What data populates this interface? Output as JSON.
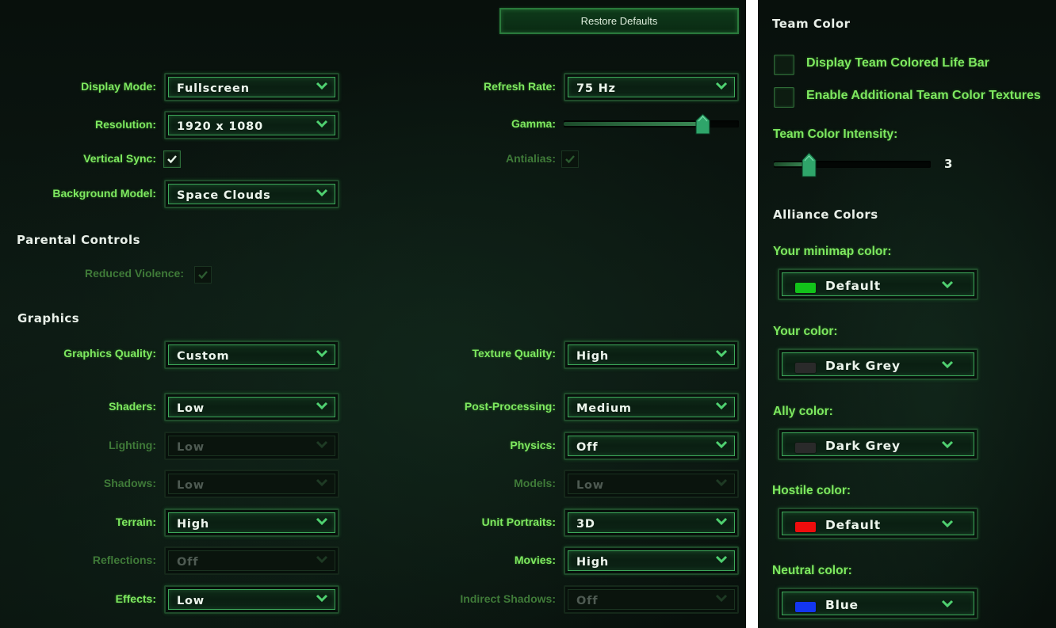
{
  "restore_defaults": "Restore Defaults",
  "video": {
    "display_mode": {
      "label": "Display Mode:",
      "value": "Fullscreen"
    },
    "resolution": {
      "label": "Resolution:",
      "value": "1920 x 1080"
    },
    "vertical_sync": {
      "label": "Vertical Sync:",
      "checked": true
    },
    "background_model": {
      "label": "Background Model:",
      "value": "Space Clouds"
    },
    "refresh_rate": {
      "label": "Refresh Rate:",
      "value": "75 Hz"
    },
    "gamma": {
      "label": "Gamma:",
      "level": 0.79
    },
    "antialias": {
      "label": "Antialias:",
      "checked": true,
      "enabled": false
    }
  },
  "parental_controls": {
    "title": "Parental Controls",
    "reduced_violence": {
      "label": "Reduced Violence:",
      "checked": true,
      "enabled": false
    }
  },
  "graphics": {
    "title": "Graphics",
    "graphics_quality": {
      "label": "Graphics Quality:",
      "value": "Custom"
    },
    "shaders": {
      "label": "Shaders:",
      "value": "Low"
    },
    "lighting": {
      "label": "Lighting:",
      "value": "Low",
      "enabled": false
    },
    "shadows": {
      "label": "Shadows:",
      "value": "Low",
      "enabled": false
    },
    "terrain": {
      "label": "Terrain:",
      "value": "High"
    },
    "reflections": {
      "label": "Reflections:",
      "value": "Off",
      "enabled": false
    },
    "effects": {
      "label": "Effects:",
      "value": "Low"
    },
    "texture_quality": {
      "label": "Texture Quality:",
      "value": "High"
    },
    "post_processing": {
      "label": "Post-Processing:",
      "value": "Medium"
    },
    "physics": {
      "label": "Physics:",
      "value": "Off"
    },
    "models": {
      "label": "Models:",
      "value": "Low",
      "enabled": false
    },
    "unit_portraits": {
      "label": "Unit Portraits:",
      "value": "3D"
    },
    "movies": {
      "label": "Movies:",
      "value": "High"
    },
    "indirect_shadows": {
      "label": "Indirect Shadows:",
      "value": "Off",
      "enabled": false
    }
  },
  "team_color": {
    "title": "Team Color",
    "life_bar": {
      "label": "Display Team Colored Life Bar",
      "checked": false
    },
    "textures": {
      "label": "Enable Additional Team Color Textures",
      "checked": false
    },
    "intensity": {
      "label": "Team Color Intensity:",
      "value": "3",
      "level": 0.22
    }
  },
  "alliance_colors": {
    "title": "Alliance Colors",
    "minimap": {
      "label": "Your minimap color:",
      "value": "Default",
      "swatch": "#12c21a"
    },
    "your_color": {
      "label": "Your color:",
      "value": "Dark Grey",
      "swatch": "#2a2a2a"
    },
    "ally": {
      "label": "Ally color:",
      "value": "Dark Grey",
      "swatch": "#2a2a2a"
    },
    "hostile": {
      "label": "Hostile color:",
      "value": "Default",
      "swatch": "#ee0d0d"
    },
    "neutral": {
      "label": "Neutral color:",
      "value": "Blue",
      "swatch": "#1336f0"
    }
  }
}
